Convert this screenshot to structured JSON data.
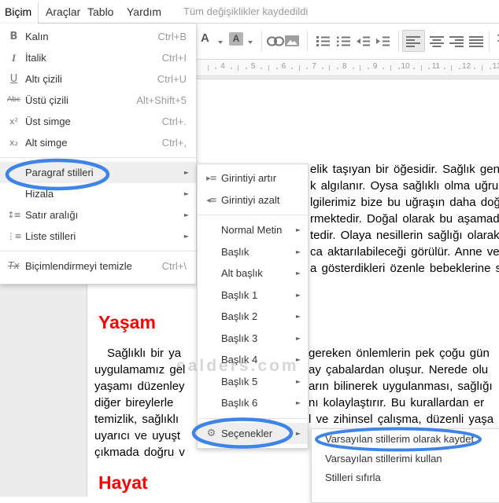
{
  "menubar": {
    "items": [
      "Biçim",
      "Araçlar",
      "Tablo",
      "Yardım"
    ],
    "status": "Tüm değişiklikler kaydedildi"
  },
  "toolbar": {
    "text_color_label": "A",
    "highlight_label": "A",
    "buttons": [
      "text-color",
      "highlight-color",
      "insert-link",
      "insert-image",
      "numbered-list",
      "bulleted-list",
      "decrease-indent",
      "increase-indent",
      "align-left",
      "align-center",
      "align-right",
      "justify",
      "line-spacing"
    ],
    "active_button": "align-left",
    "line_spacing_glyph": "↕"
  },
  "ruler": {
    "numbers": [
      4,
      5,
      6,
      7,
      8,
      9,
      10,
      11,
      12,
      13
    ]
  },
  "ui": {
    "submenu_arrow": "►"
  },
  "icons": {
    "bold-icon": "B",
    "italic-icon": "I",
    "underline-icon": "U",
    "strikethrough-icon": "Abc",
    "superscript-icon": "x²",
    "subscript-icon": "x₂",
    "line-spacing-icon": "↕≡",
    "list-styles-icon": "⋮≡",
    "clear-formatting-icon": "Tx",
    "indent-increase-icon": "▸≡",
    "indent-decrease-icon": "◂≡",
    "gear-icon": "⚙"
  },
  "format_menu": {
    "items": [
      {
        "icon": "bold-icon",
        "label": "Kalın",
        "shortcut": "Ctrl+B"
      },
      {
        "icon": "italic-icon",
        "label": "İtalik",
        "shortcut": "Ctrl+I"
      },
      {
        "icon": "underline-icon",
        "label": "Altı çizili",
        "shortcut": "Ctrl+U"
      },
      {
        "icon": "strikethrough-icon",
        "label": "Üstü çizili",
        "shortcut": "Alt+Shift+5"
      },
      {
        "icon": "superscript-icon",
        "label": "Üst simge",
        "shortcut": "Ctrl+."
      },
      {
        "icon": "subscript-icon",
        "label": "Alt simge",
        "shortcut": "Ctrl+,"
      },
      {
        "type": "separator"
      },
      {
        "label": "Paragraf stilleri",
        "submenu": true,
        "highlighted": true
      },
      {
        "label": "Hizala",
        "submenu": true
      },
      {
        "icon": "line-spacing-icon",
        "label": "Satır aralığı",
        "submenu": true
      },
      {
        "icon": "list-styles-icon",
        "label": "Liste stilleri",
        "submenu": true
      },
      {
        "type": "separator"
      },
      {
        "icon": "clear-formatting-icon",
        "label": "Biçimlendirmeyi temizle",
        "shortcut": "Ctrl+\\"
      }
    ]
  },
  "styles_submenu": {
    "items": [
      {
        "icon": "indent-increase-icon",
        "label": "Girintiyi artır"
      },
      {
        "icon": "indent-decrease-icon",
        "label": "Girintiyi azalt"
      },
      {
        "type": "separator"
      },
      {
        "label": "Normal Metin",
        "submenu": true
      },
      {
        "label": "Başlık",
        "submenu": true
      },
      {
        "label": "Alt başlık",
        "submenu": true
      },
      {
        "label": "Başlık 1",
        "submenu": true
      },
      {
        "label": "Başlık 2",
        "submenu": true
      },
      {
        "label": "Başlık 3",
        "submenu": true
      },
      {
        "label": "Başlık 4",
        "submenu": true
      },
      {
        "label": "Başlık 5",
        "submenu": true
      },
      {
        "label": "Başlık 6",
        "submenu": true
      },
      {
        "type": "separator"
      },
      {
        "icon": "gear-icon",
        "label": "Seçenekler",
        "submenu": true,
        "highlighted": true
      }
    ]
  },
  "options_submenu": {
    "items": [
      {
        "label": "Varsayılan stillerim olarak kaydet"
      },
      {
        "label": "Varsayılan stillerimi kullan"
      },
      {
        "label": "Stilleri sıfırla"
      }
    ]
  },
  "document": {
    "heading1": "Yaşam",
    "heading2": "Hayat",
    "para1_lines": [
      "elik taşıyan bir öğesidir. Sağlık gene",
      "k algılanır. Oysa sağlıklı olma uğrund",
      "lgilerimiz bize bu uğraşın daha doğru",
      "rmektedir. Doğal olarak bu aşamada",
      "tedir. Olaya nesillerin sağlığı olarak",
      "ca aktarılabileceği görülür. Anne ve",
      "a gösterdikleri özenle bebeklerine s"
    ],
    "para2_left_lines": [
      "Sağlıklı bir ya",
      "uygulamamız gel",
      "yaşamı düzenley",
      "diğer bireylerle",
      "temizlik, sağlıklı",
      "uyarıcı ve uyuşt",
      "çıkmada doğru v"
    ],
    "para2_right_lines": [
      "gereken önlemlerin pek çoğu gün",
      "ay çabalardan oluşur. Nerede olu",
      "arın bilinerek uygulanması, sağlığı",
      "nı kolaylaştırır. Bu kurallardan er",
      "l ve zihinsel çalışma, düzenli yaşa"
    ],
    "watermark": "ealders.com"
  },
  "colors": {
    "annotation_blue": "#2f7be5",
    "heading_red": "#ff0000",
    "highlight_row": "#eeeeee"
  }
}
